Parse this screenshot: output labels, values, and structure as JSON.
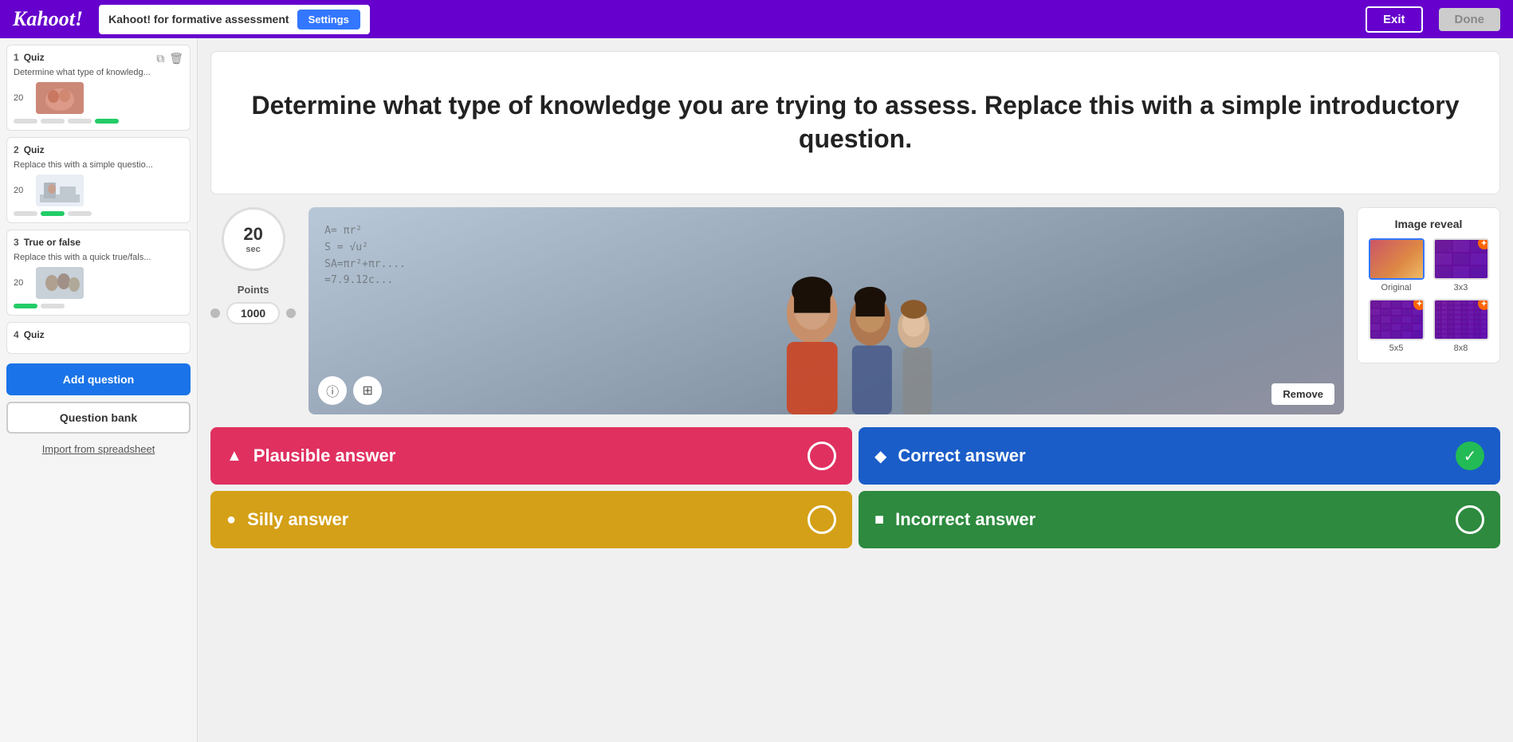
{
  "header": {
    "logo": "Kahoot!",
    "title": "Kahoot! for formative assessment",
    "settings_label": "Settings",
    "exit_label": "Exit",
    "done_label": "Done"
  },
  "sidebar": {
    "items": [
      {
        "num": "1",
        "type": "Quiz",
        "title": "Determine what type of knowledg...",
        "time": "20"
      },
      {
        "num": "2",
        "type": "Quiz",
        "title": "Replace this with a simple questio...",
        "time": "20"
      },
      {
        "num": "3",
        "type": "True or false",
        "title": "Replace this with a quick true/fals...",
        "time": "20"
      },
      {
        "num": "4",
        "type": "Quiz",
        "title": "",
        "time": ""
      }
    ],
    "add_question_label": "Add question",
    "question_bank_label": "Question bank",
    "import_label": "Import from spreadsheet"
  },
  "question": {
    "text": "Determine what type of knowledge you are trying to assess. Replace this with a simple introductory question."
  },
  "controls": {
    "timer_value": "20",
    "timer_unit": "sec",
    "points_label": "Points",
    "points_value": "1000"
  },
  "image": {
    "remove_label": "Remove",
    "reveal": {
      "title": "Image reveal",
      "options": [
        {
          "label": "Original",
          "type": "original",
          "selected": true
        },
        {
          "label": "3x3",
          "type": "3x3",
          "badge": true
        },
        {
          "label": "5x5",
          "type": "5x5",
          "badge": true
        },
        {
          "label": "8x8",
          "type": "8x8",
          "badge": true
        }
      ]
    }
  },
  "answers": [
    {
      "id": "a1",
      "shape": "▲",
      "text": "Plausible answer",
      "color": "red",
      "correct": false
    },
    {
      "id": "a2",
      "shape": "◆",
      "text": "Correct answer",
      "color": "blue",
      "correct": true
    },
    {
      "id": "a3",
      "shape": "●",
      "text": "Silly answer",
      "color": "yellow",
      "correct": false
    },
    {
      "id": "a4",
      "shape": "■",
      "text": "Incorrect answer",
      "color": "green",
      "correct": false
    }
  ]
}
